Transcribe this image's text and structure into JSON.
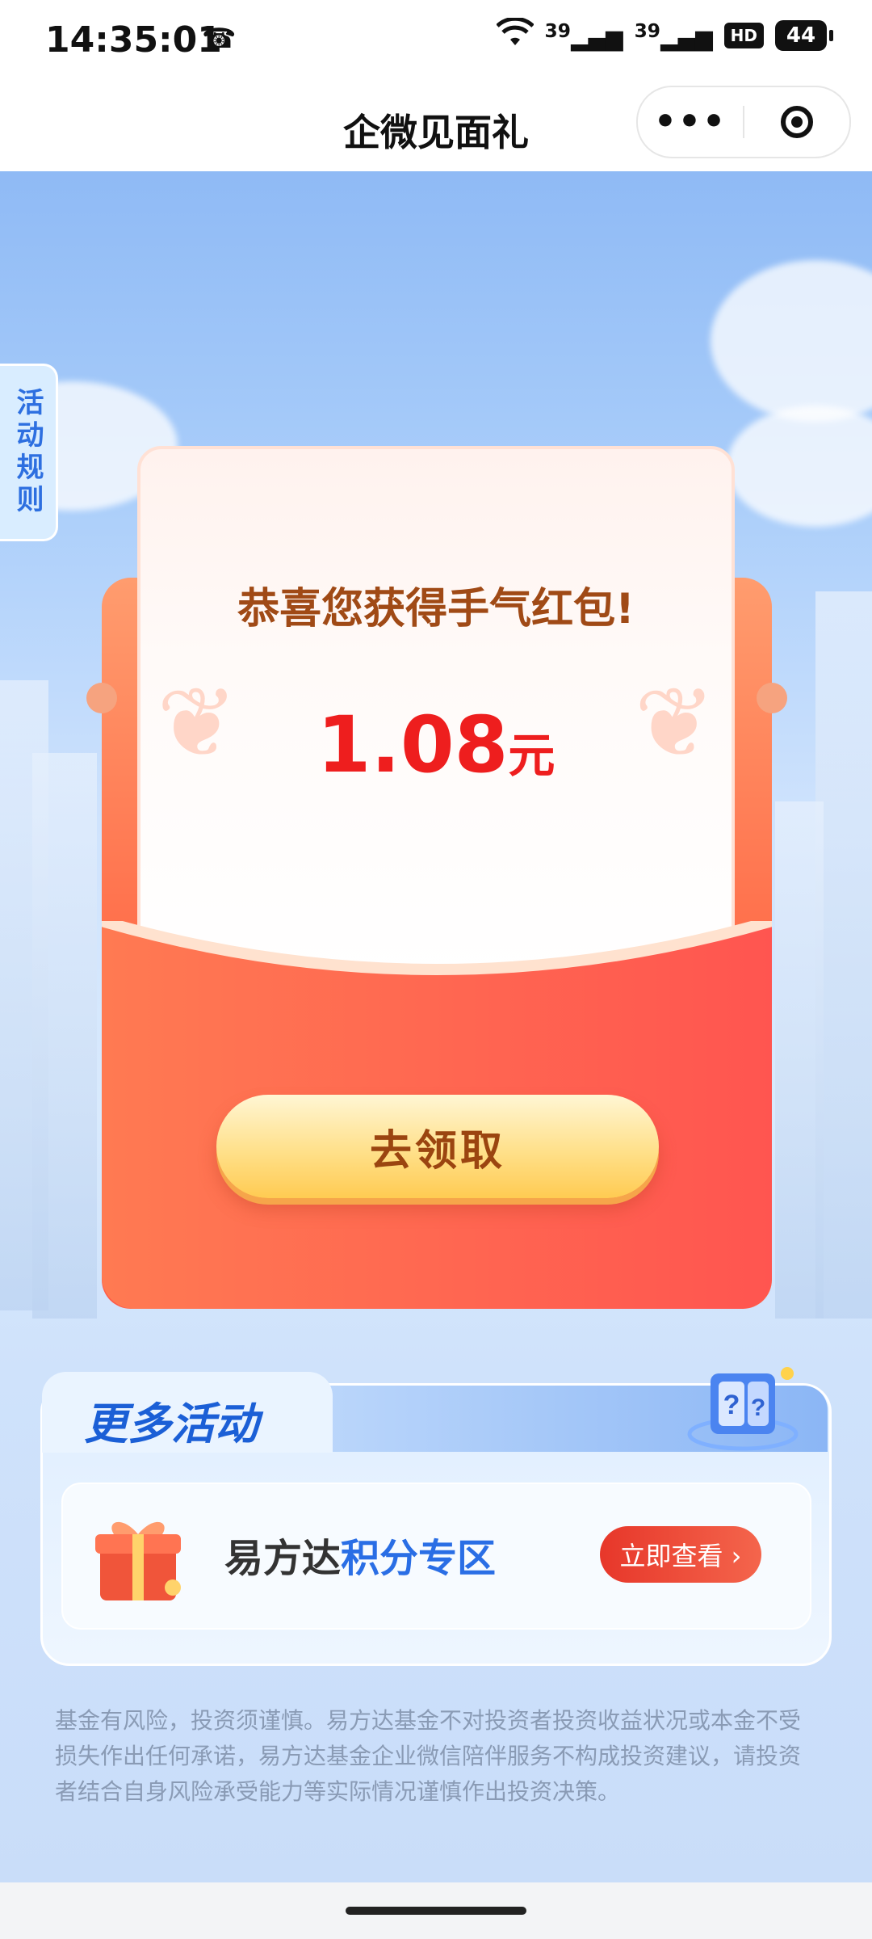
{
  "status_bar": {
    "time": "14:35:01",
    "signal_1": "39",
    "signal_2": "39",
    "battery": "44"
  },
  "nav": {
    "title": "企微见面礼",
    "more_label": "•••"
  },
  "rule_tab": {
    "label": "活动规则"
  },
  "red_packet": {
    "congrats": "恭喜您获得手气红包!",
    "amount": "1.08",
    "unit": "元",
    "claim_label": "去领取"
  },
  "more_activities": {
    "title": "更多活动",
    "promo_prefix": "易方达",
    "promo_highlight": "积分专区",
    "view_label": "立即查看 ›"
  },
  "disclaimer": "基金有风险，投资须谨慎。易方达基金不对投资者投资收益状况或本金不受损失作出任何承诺，易方达基金企业微信陪伴服务不构成投资建议，请投资者结合自身风险承受能力等实际情况谨慎作出投资决策。",
  "colors": {
    "accent_blue": "#2a6ee5",
    "packet_red": "#ff5a48",
    "amount_red": "#ee1e1e",
    "button_gold": "#ffd66b"
  }
}
